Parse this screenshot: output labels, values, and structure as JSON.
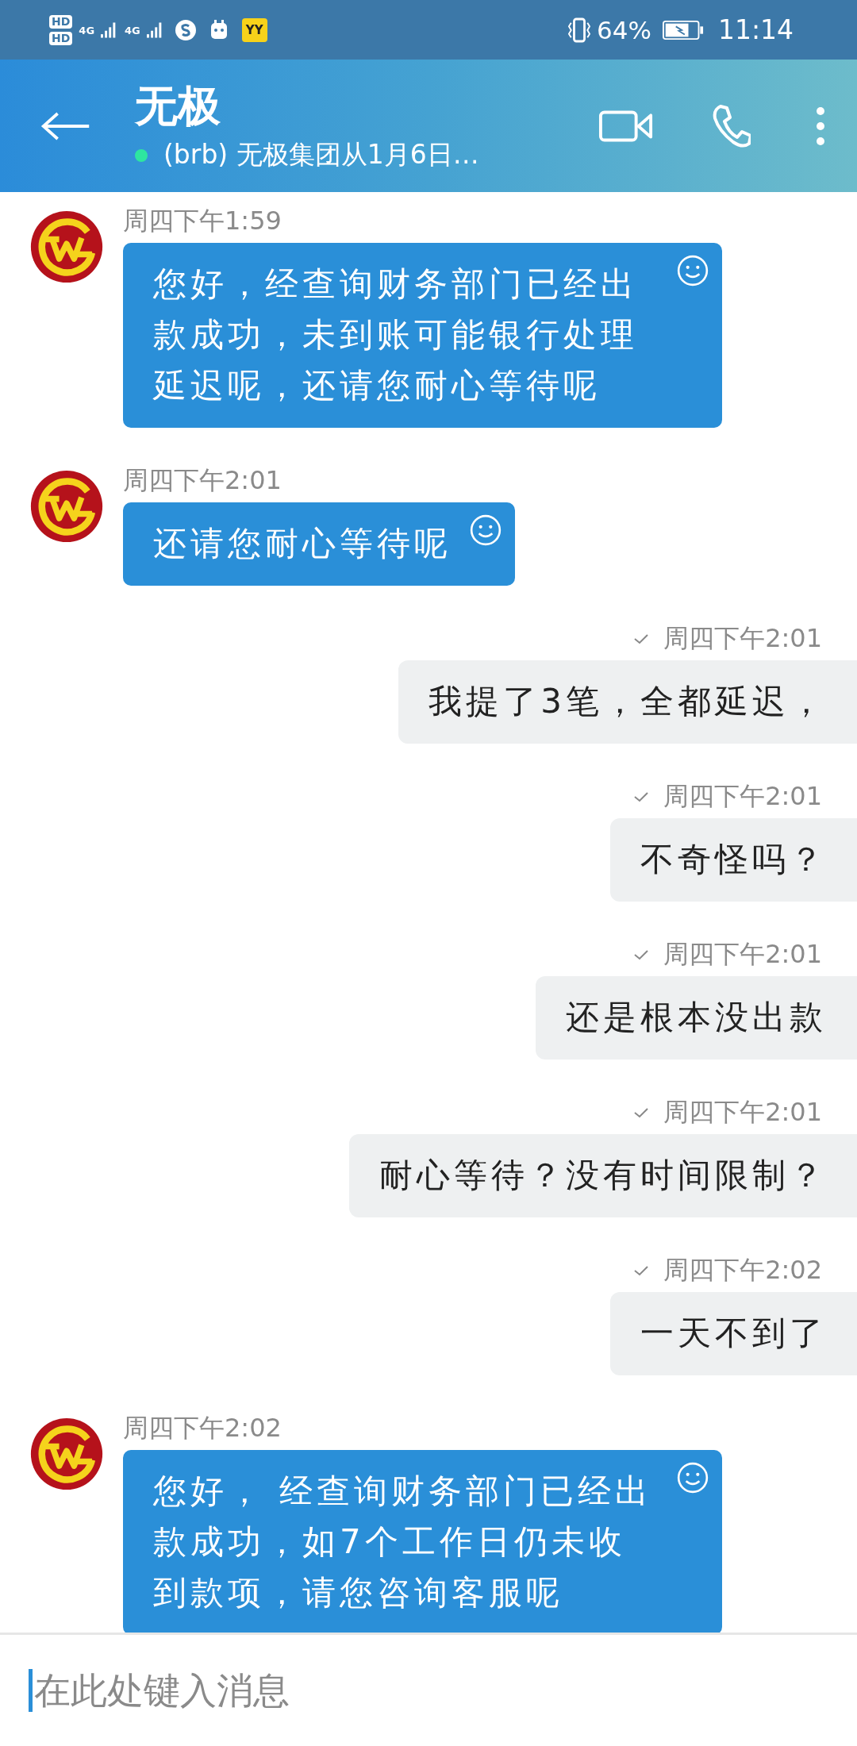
{
  "status_bar": {
    "sim_labels": [
      "HD",
      "HD"
    ],
    "network_labels": [
      "4G",
      "4G"
    ],
    "app_badge": "YY",
    "battery": "64%",
    "time": "11:14"
  },
  "header": {
    "title": "无极",
    "online": true,
    "subtitle": "(brb) 无极集团从1月6日…"
  },
  "messages": [
    {
      "kind": "in",
      "time": "周四下午1:59",
      "text": "您好，经查询财务部门已经出款成功，未到账可能银行处理延迟呢，还请您耐心等待呢"
    },
    {
      "kind": "in",
      "time": "周四下午2:01",
      "text": "还请您耐心等待呢"
    },
    {
      "kind": "out",
      "time": "周四下午2:01",
      "sent": true,
      "text": "我提了3笔，全都延迟，"
    },
    {
      "kind": "out",
      "time": "周四下午2:01",
      "sent": true,
      "text": "不奇怪吗？"
    },
    {
      "kind": "out",
      "time": "周四下午2:01",
      "sent": true,
      "text": "还是根本没出款"
    },
    {
      "kind": "out",
      "time": "周四下午2:01",
      "sent": true,
      "text": "耐心等待？没有时间限制？"
    },
    {
      "kind": "out",
      "time": "周四下午2:02",
      "sent": true,
      "text": "一天不到了"
    },
    {
      "kind": "in",
      "time": "周四下午2:02",
      "text": "您好， 经查询财务部门已经出款成功，如7个工作日仍未收到款项，请您咨询客服呢"
    }
  ],
  "composer": {
    "placeholder": "在此处键入消息"
  }
}
